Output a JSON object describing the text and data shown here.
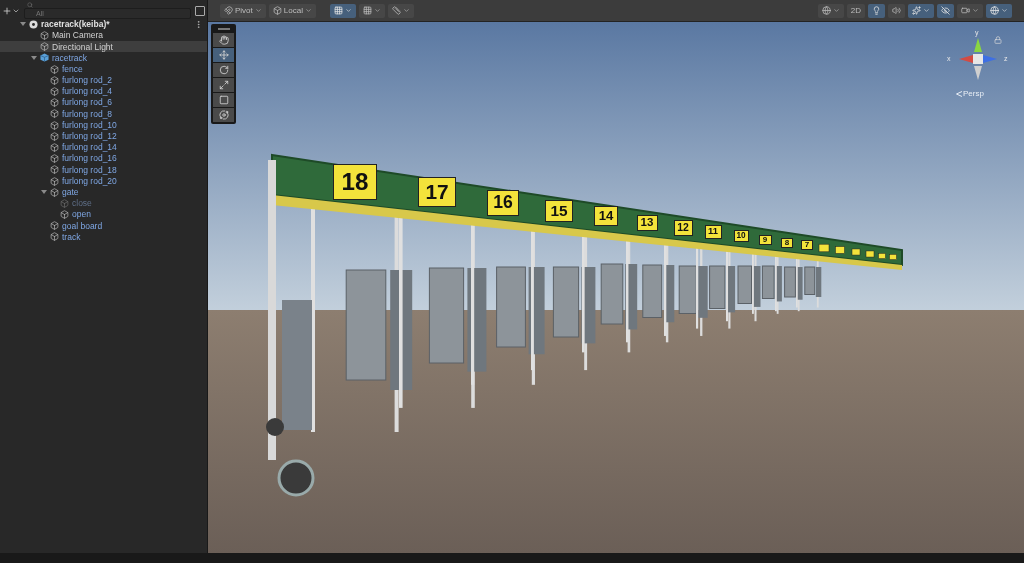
{
  "hierarchy": {
    "search": {
      "placeholder": "All"
    },
    "scene": {
      "label": "racetrack(keiba)*",
      "expanded": true,
      "children": [
        {
          "label": "Main Camera",
          "kind": "object",
          "selected": false
        },
        {
          "label": "Directional Light",
          "kind": "object",
          "selected": true
        },
        {
          "label": "racetrack",
          "kind": "prefab_root",
          "selected": false,
          "expanded": true,
          "children": [
            {
              "label": "fence",
              "kind": "prefab",
              "selected": false
            },
            {
              "label": "furlong rod_2",
              "kind": "prefab",
              "selected": false
            },
            {
              "label": "furlong rod_4",
              "kind": "prefab",
              "selected": false
            },
            {
              "label": "furlong rod_6",
              "kind": "prefab",
              "selected": false
            },
            {
              "label": "furlong rod_8",
              "kind": "prefab",
              "selected": false
            },
            {
              "label": "furlong rod_10",
              "kind": "prefab",
              "selected": false
            },
            {
              "label": "furlong rod_12",
              "kind": "prefab",
              "selected": false
            },
            {
              "label": "furlong rod_14",
              "kind": "prefab",
              "selected": false
            },
            {
              "label": "furlong rod_16",
              "kind": "prefab",
              "selected": false
            },
            {
              "label": "furlong rod_18",
              "kind": "prefab",
              "selected": false
            },
            {
              "label": "furlong rod_20",
              "kind": "prefab",
              "selected": false
            },
            {
              "label": "gate",
              "kind": "prefab",
              "selected": false,
              "expanded": true,
              "children": [
                {
                  "label": "close",
                  "kind": "prefab",
                  "selected": false,
                  "disabled": true
                },
                {
                  "label": "open",
                  "kind": "prefab",
                  "selected": false,
                  "disabled": false
                }
              ]
            },
            {
              "label": "goal board",
              "kind": "prefab",
              "selected": false
            },
            {
              "label": "track",
              "kind": "prefab",
              "selected": false
            }
          ]
        }
      ]
    }
  },
  "scene_toolbar": {
    "pivot": "Pivot",
    "space": "Local",
    "grid_snap_on": true,
    "view_2d": "2D",
    "lighting_on": true,
    "audio_on": false,
    "effects_on": true,
    "hidden_objects_on": true,
    "camera_on": false,
    "gizmos_on": true
  },
  "tools": [
    {
      "kind": "hand",
      "selected": false
    },
    {
      "kind": "move",
      "selected": true
    },
    {
      "kind": "rotate",
      "selected": false
    },
    {
      "kind": "scale",
      "selected": false
    },
    {
      "kind": "rect",
      "selected": false
    },
    {
      "kind": "transform",
      "selected": false
    }
  ],
  "orientation_gizmo": {
    "y": "y",
    "x": "x",
    "z": "z",
    "projection": "Persp"
  },
  "gate_numbers": [
    "18",
    "17",
    "16",
    "15",
    "14",
    "13",
    "12",
    "11",
    "10",
    "9",
    "8",
    "7"
  ]
}
